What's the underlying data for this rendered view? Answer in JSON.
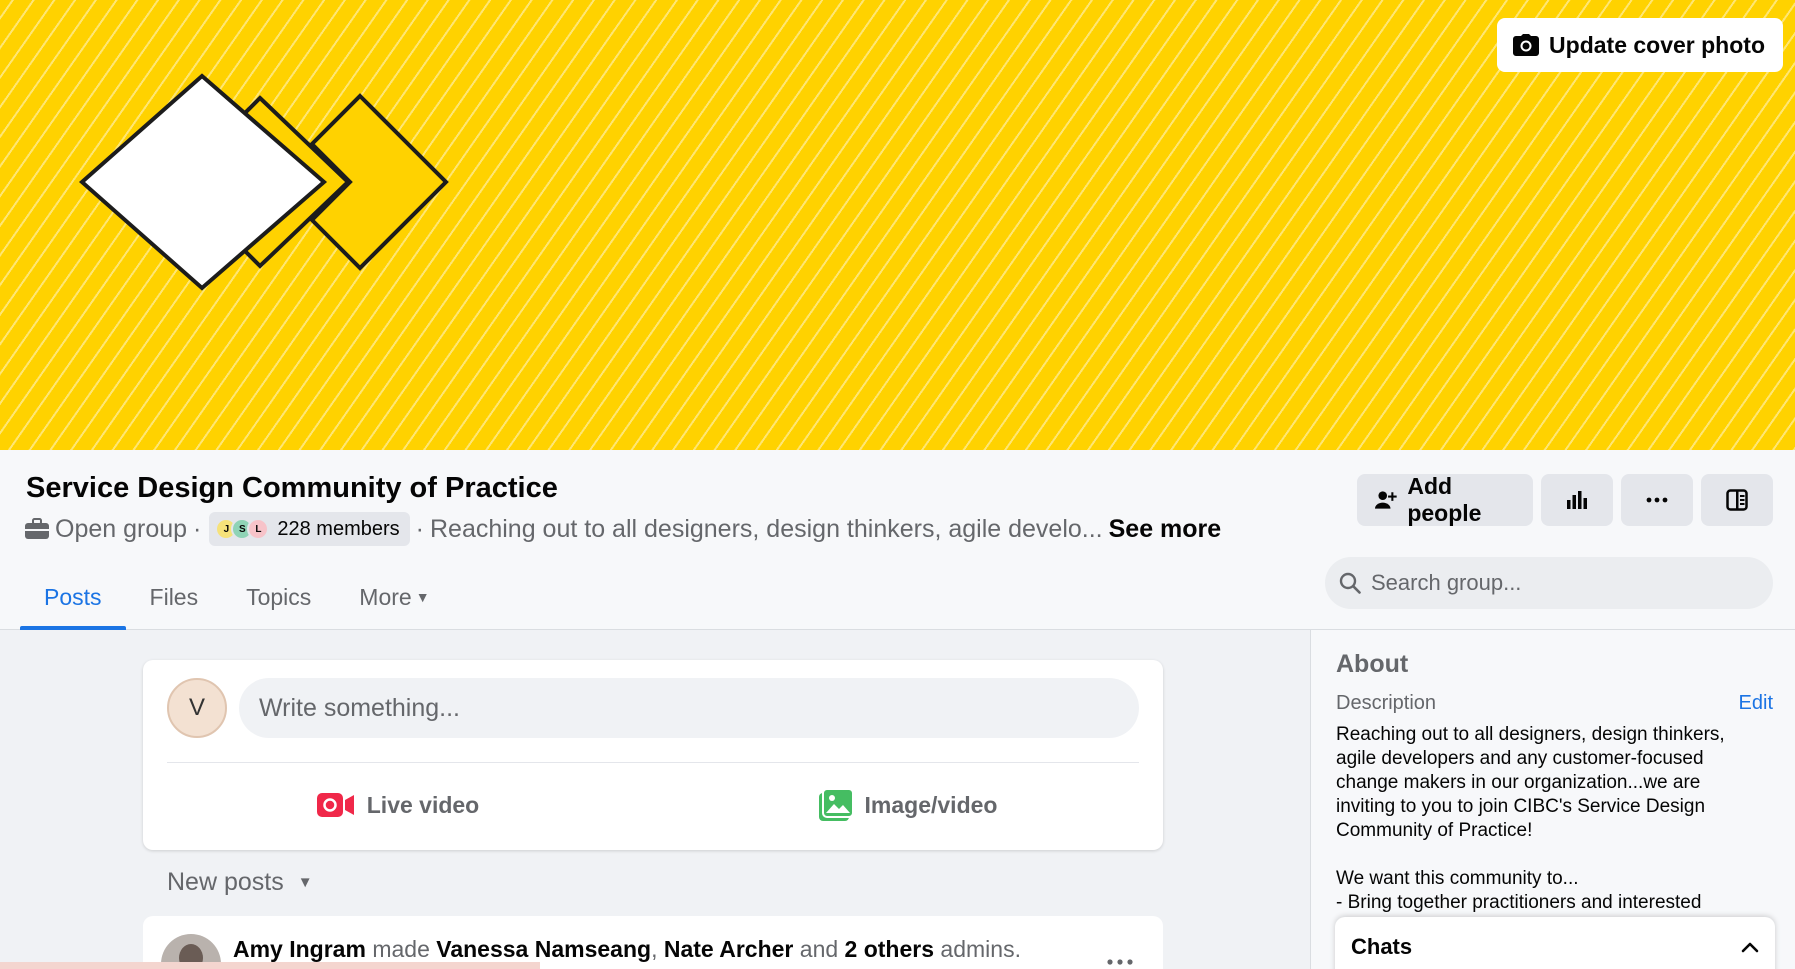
{
  "cover": {
    "update_cover_label": "Update cover photo",
    "background_color": "#ffd200",
    "art_outline_color": "#1c1c1c"
  },
  "group": {
    "name": "Service Design Community of Practice",
    "privacy": "Open group",
    "member_initials": [
      "J",
      "S",
      "L"
    ],
    "members_label": "228 members",
    "description_snippet": "Reaching out to all designers, design thinkers, agile develo...",
    "see_more": "See more"
  },
  "actions": {
    "add_people": "Add people"
  },
  "tabs": [
    {
      "label": "Posts",
      "active": true
    },
    {
      "label": "Files",
      "active": false
    },
    {
      "label": "Topics",
      "active": false
    },
    {
      "label": "More",
      "active": false
    }
  ],
  "search": {
    "placeholder": "Search group..."
  },
  "composer": {
    "avatar_initial": "V",
    "placeholder": "Write something...",
    "live_video": "Live video",
    "image_video": "Image/video"
  },
  "feed": {
    "new_posts_label": "New posts",
    "post": {
      "actor": "Amy Ingram",
      "verb": "made",
      "target1": "Vanessa Namseang",
      "target2": "Nate Archer",
      "conj": "and",
      "others": "2 others",
      "suffix": "admins."
    }
  },
  "sidebar": {
    "about": "About",
    "description_label": "Description",
    "edit": "Edit",
    "description": "Reaching out to all designers, design thinkers, agile developers and any customer-focused change makers in our organization...we are inviting to you to join CIBC's Service Design Community of Practice!\n\nWe want this community to...\n- Bring together practitioners and interested"
  },
  "chats": {
    "label": "Chats"
  },
  "colors": {
    "accent": "#1b74e4",
    "live_red": "#f02849",
    "photo_green": "#45bd62"
  }
}
